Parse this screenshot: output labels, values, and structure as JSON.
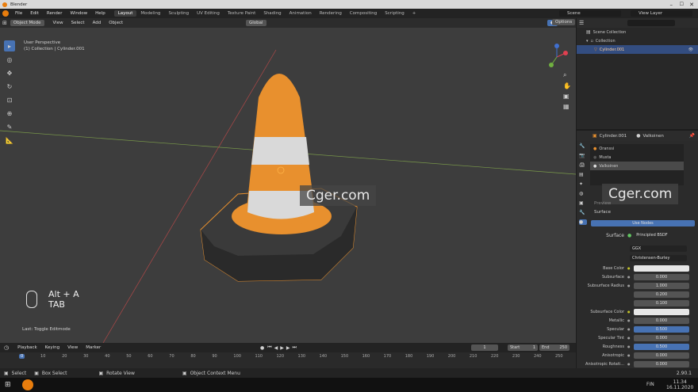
{
  "window": {
    "title": "Blender"
  },
  "menu": [
    "File",
    "Edit",
    "Render",
    "Window",
    "Help"
  ],
  "workspaces": [
    "Layout",
    "Modeling",
    "Sculpting",
    "UV Editing",
    "Texture Paint",
    "Shading",
    "Animation",
    "Rendering",
    "Compositing",
    "Scripting"
  ],
  "active_workspace": "Layout",
  "scene": "Scene",
  "view_layer": "View Layer",
  "viewport": {
    "mode": "Object Mode",
    "menus": [
      "View",
      "Select",
      "Add",
      "Object"
    ],
    "orientation": "Global",
    "options": "Options",
    "info_line1": "User Perspective",
    "info_line2": "(1) Collection | Cylinder.001",
    "keys_line1": "Alt + A",
    "keys_line2": "TAB",
    "last_op": "Last: Toggle Editmode"
  },
  "watermark": "Cger.com",
  "outliner": {
    "root": "Scene Collection",
    "collection": "Collection",
    "object": "Cylinder.001"
  },
  "properties": {
    "object": "Cylinder.001",
    "material": "Valkoinen",
    "slots": [
      "Oranssi",
      "Musta",
      "Valkoinen"
    ],
    "preview": "Preview",
    "surface_header": "Surface",
    "use_nodes": "Use Nodes",
    "surface_label": "Surface",
    "surface_value": "Principled BSDF",
    "distribution": "GGX",
    "subsurface_method": "Christensen-Burley",
    "rows": [
      {
        "label": "Base Color",
        "value": "",
        "kind": "light"
      },
      {
        "label": "Subsurface",
        "value": "0.000",
        "kind": "dark"
      },
      {
        "label": "Subsurface Radius",
        "value": "1.000",
        "kind": "dark"
      },
      {
        "label": "",
        "value": "0.200",
        "kind": "dark"
      },
      {
        "label": "",
        "value": "0.100",
        "kind": "dark"
      },
      {
        "label": "Subsurface Color",
        "value": "",
        "kind": "light"
      },
      {
        "label": "Metallic",
        "value": "0.000",
        "kind": "dark"
      },
      {
        "label": "Specular",
        "value": "0.500",
        "kind": "blue"
      },
      {
        "label": "Specular Tint",
        "value": "0.000",
        "kind": "dark"
      },
      {
        "label": "Roughness",
        "value": "0.500",
        "kind": "blue"
      },
      {
        "label": "Anisotropic",
        "value": "0.000",
        "kind": "dark"
      },
      {
        "label": "Anisotropic Rotati...",
        "value": "0.000",
        "kind": "dark"
      }
    ]
  },
  "timeline": {
    "menus": [
      "Playback",
      "Keying",
      "View",
      "Marker"
    ],
    "current_frame": "1",
    "start_label": "Start",
    "start": "1",
    "end_label": "End",
    "end": "250",
    "ticks": [
      "0",
      "10",
      "20",
      "30",
      "40",
      "50",
      "60",
      "70",
      "80",
      "90",
      "100",
      "110",
      "120",
      "130",
      "140",
      "150",
      "160",
      "170",
      "180",
      "190",
      "200",
      "210",
      "220",
      "230",
      "240",
      "250"
    ]
  },
  "status": {
    "select": "Select",
    "box_select": "Box Select",
    "rotate": "Rotate View",
    "context": "Object Context Menu",
    "version": "2.90.1"
  },
  "taskbar": {
    "lang": "FIN",
    "time": "11.34",
    "date": "16.11.2020"
  },
  "colors": {
    "accent": "#4772b3",
    "cone_orange": "#e8902e",
    "cone_white": "#d9d9d9",
    "base_dark": "#3a3a3a"
  }
}
